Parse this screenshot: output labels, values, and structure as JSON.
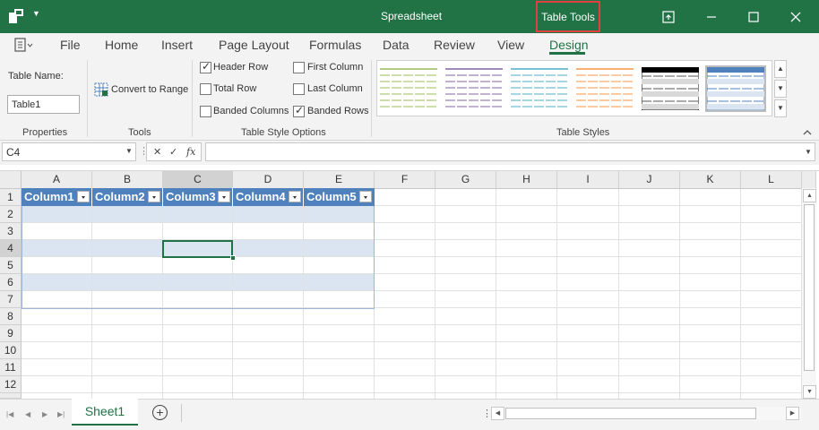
{
  "window": {
    "title": "Spreadsheet",
    "context_tab": "Table Tools"
  },
  "ribbon_tabs": [
    "File",
    "Home",
    "Insert",
    "Page Layout",
    "Formulas",
    "Data",
    "Review",
    "View",
    "Design"
  ],
  "active_tab": "Design",
  "properties": {
    "table_name_label": "Table Name:",
    "table_name_value": "Table1",
    "group_label": "Properties"
  },
  "tools": {
    "convert_label": "Convert to Range",
    "group_label": "Tools"
  },
  "style_options": {
    "group_label": "Table Style Options",
    "header_row": {
      "label": "Header Row",
      "checked": true
    },
    "total_row": {
      "label": "Total Row",
      "checked": false
    },
    "banded_columns": {
      "label": "Banded Columns",
      "checked": false
    },
    "first_column": {
      "label": "First Column",
      "checked": false
    },
    "last_column": {
      "label": "Last Column",
      "checked": false
    },
    "banded_rows": {
      "label": "Banded Rows",
      "checked": true
    }
  },
  "table_styles": {
    "group_label": "Table Styles",
    "swatches": [
      {
        "name": "green-light",
        "color": "#9bbb59"
      },
      {
        "name": "purple-light",
        "color": "#8064a2"
      },
      {
        "name": "aqua-light",
        "color": "#4bacc6"
      },
      {
        "name": "orange-light",
        "color": "#f79646"
      },
      {
        "name": "black-medium",
        "color": "#000000"
      },
      {
        "name": "blue-medium",
        "color": "#4f81bd"
      }
    ],
    "selected": 5
  },
  "formula_bar": {
    "name_box": "C4",
    "formula": ""
  },
  "grid": {
    "columns": [
      "A",
      "B",
      "C",
      "D",
      "E",
      "F",
      "G",
      "H",
      "I",
      "J",
      "K",
      "L"
    ],
    "rows": [
      "1",
      "2",
      "3",
      "4",
      "5",
      "6",
      "7",
      "8",
      "9",
      "10",
      "11",
      "12"
    ],
    "table_headers": [
      "Column1",
      "Column2",
      "Column3",
      "Column4",
      "Column5"
    ],
    "active_cell": "C4"
  },
  "sheets": [
    "Sheet1"
  ],
  "active_sheet": "Sheet1",
  "colors": {
    "accent": "#217346",
    "table_header": "#4f81bd",
    "band": "#dbe5f1",
    "highlight_border": "#e0403f"
  }
}
